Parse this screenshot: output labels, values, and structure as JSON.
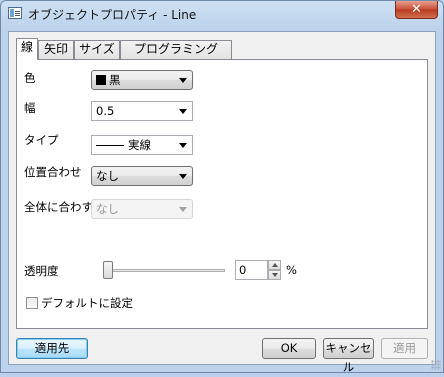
{
  "window": {
    "title": "オブジェクトプロパティ - Line",
    "close_glyph": "✕",
    "icon": "app-icon"
  },
  "tabs": [
    {
      "label": "線",
      "active": true
    },
    {
      "label": "矢印",
      "active": false
    },
    {
      "label": "サイズ",
      "active": false
    },
    {
      "label": "プログラミング",
      "active": false
    }
  ],
  "line_tab": {
    "color": {
      "label": "色",
      "value": "黒",
      "swatch": "#000000"
    },
    "width": {
      "label": "幅",
      "value": "0.5"
    },
    "type": {
      "label": "タイプ",
      "value": "実線"
    },
    "position": {
      "label": "位置合わせ",
      "value": "なし"
    },
    "global_align": {
      "label": "全体に合わす",
      "value": "なし"
    },
    "transparency": {
      "label": "透明度",
      "value": "0",
      "unit": "%",
      "level_percent": 0
    },
    "default_checkbox": {
      "label": "デフォルトに設定",
      "checked": false
    }
  },
  "footer": {
    "apply_to": "適用先",
    "ok": "OK",
    "cancel": "キャンセル",
    "apply": "適用"
  }
}
